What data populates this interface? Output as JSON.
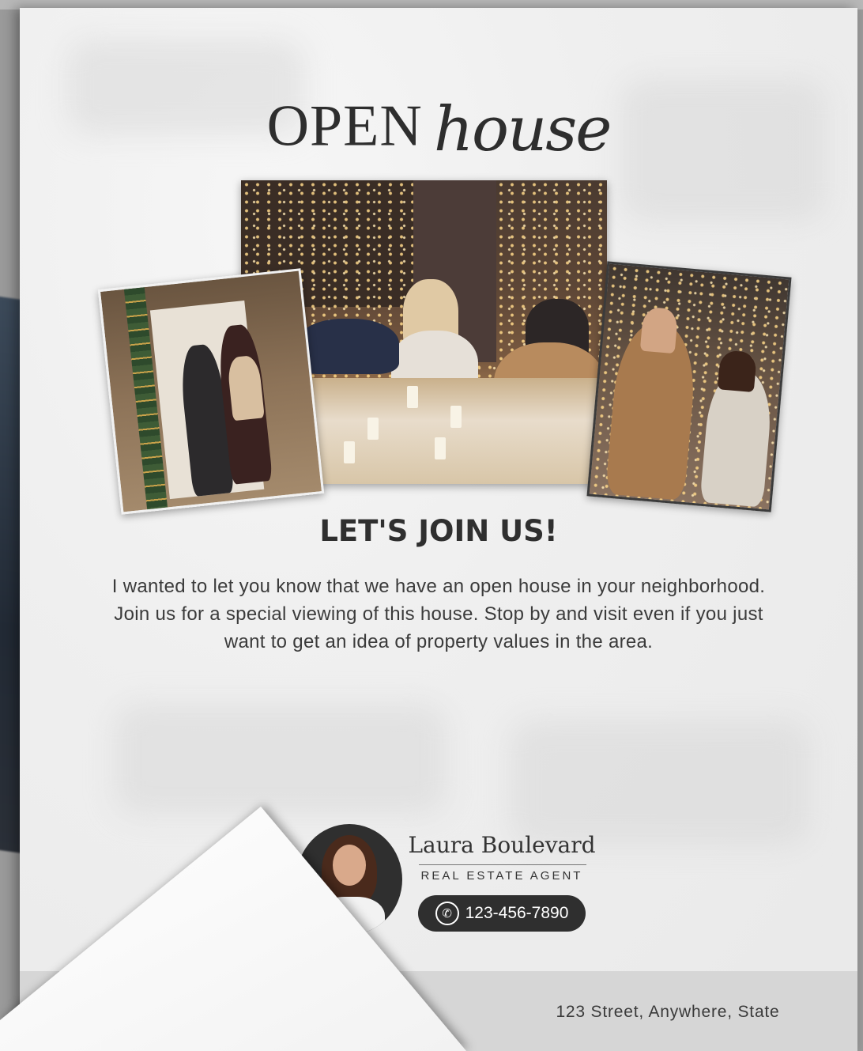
{
  "flyer": {
    "heading_open": "OPEN",
    "heading_script": "house",
    "join_title": "LET'S JOIN US!",
    "body_text": "I wanted to let you know that we have an open house in your neighborhood. Join us for a special viewing of this house. Stop by and visit even if you just want to get an idea of property values in the area.",
    "agent": {
      "name": "Laura Boulevard",
      "title": "REAL ESTATE AGENT",
      "phone": "123-456-7890"
    },
    "address": "123 Street, Anywhere, State"
  },
  "colors": {
    "text_dark": "#2f2f2f",
    "pill": "#2f2f2f",
    "footer": "#d6d6d6",
    "page": "#efefef"
  },
  "icons": [
    "phone-icon"
  ]
}
